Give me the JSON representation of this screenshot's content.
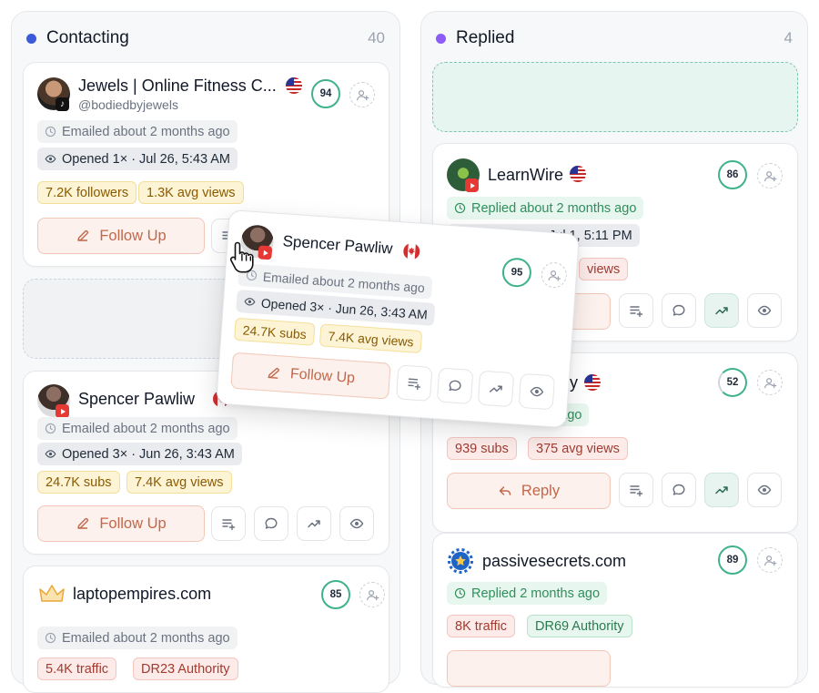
{
  "columns": [
    {
      "title": "Contacting",
      "count": "40",
      "dot": "#3b5bdb"
    },
    {
      "title": "Replied",
      "count": "4",
      "dot": "#8b5cf6"
    }
  ],
  "cards": {
    "jewels": {
      "name": "Jewels | Online Fitness C...",
      "handle": "@bodiedbyjewels",
      "score": "94",
      "status": "Emailed about 2 months ago",
      "opened": "Opened 1× · Jul 26, 5:43 AM",
      "stats": [
        "7.2K followers",
        "1.3K avg views"
      ],
      "action": "Follow Up"
    },
    "spencer": {
      "name": "Spencer Pawliw",
      "score": "95",
      "status": "Emailed about 2 months ago",
      "opened": "Opened 3× · Jun 26, 3:43 AM",
      "stats": [
        "24.7K subs",
        "7.4K avg views"
      ],
      "action": "Follow Up"
    },
    "laptop": {
      "name": "laptopempires.com",
      "score": "85",
      "status": "Emailed about 2 months ago",
      "stats": [
        "5.4K traffic",
        "DR23 Authority"
      ]
    },
    "learnwire": {
      "name": "LearnWire",
      "score": "86",
      "status": "Replied about 2 months ago",
      "opened": "Opened 5× · Jul 1, 5:11 PM",
      "stats": [
        "views"
      ]
    },
    "hidden": {
      "name_tail": "y",
      "score": "52",
      "status_tail": "s ago",
      "stats": [
        "939 subs",
        "375 avg views"
      ],
      "action": "Reply"
    },
    "passive": {
      "name": "passivesecrets.com",
      "score": "89",
      "status": "Replied 2 months ago",
      "stats": [
        "8K traffic",
        "DR69 Authority"
      ]
    }
  },
  "dragged": {
    "name": "Spencer Pawliw",
    "score": "95",
    "status": "Emailed about 2 months ago",
    "opened": "Opened 3× · Jun 26, 3:43 AM",
    "stats": [
      "24.7K subs",
      "7.4K avg views"
    ],
    "action": "Follow Up"
  },
  "icons": [
    "clock-icon",
    "eye-icon",
    "pencil-icon",
    "list-add-icon",
    "chat-icon",
    "trend-icon",
    "view-icon",
    "add-user-icon",
    "reply-icon",
    "hand-cursor-icon",
    "youtube-icon",
    "tiktok-icon",
    "flag-us-icon",
    "flag-ca-icon"
  ],
  "colors": {
    "accent_green": "#3fb28c",
    "follow_up": "#c2674a",
    "contacting_dot": "#3b5bdb",
    "replied_dot": "#8b5cf6"
  }
}
